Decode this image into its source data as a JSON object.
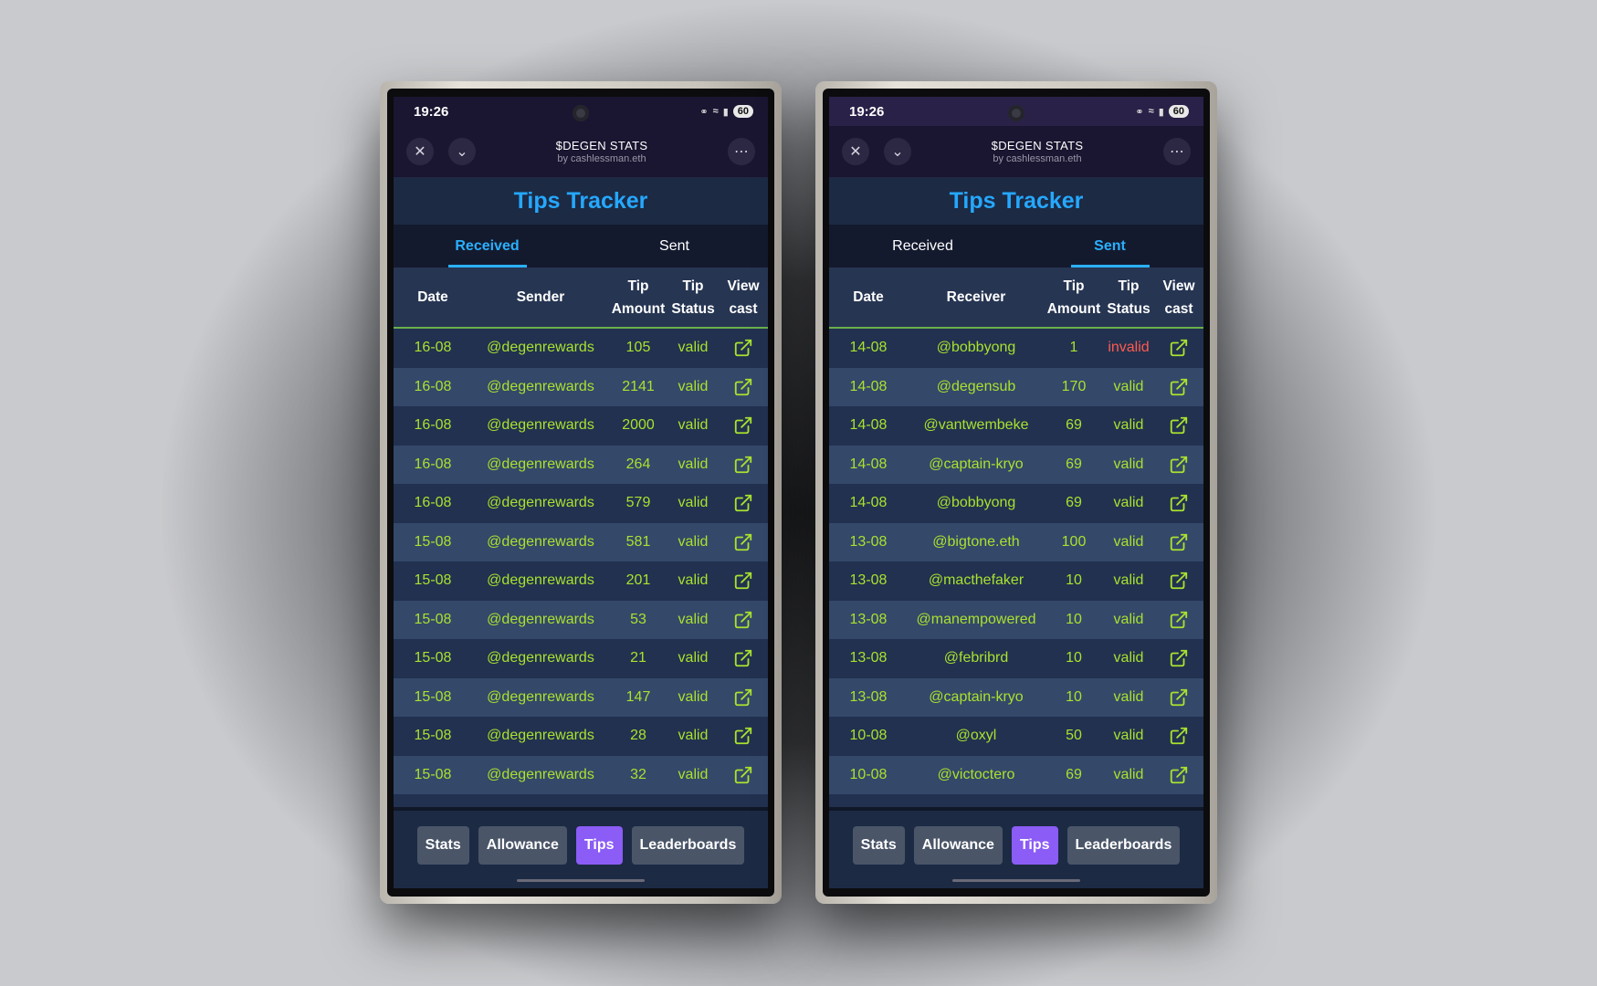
{
  "colors": {
    "accent_blue": "#25a8ff",
    "value_green": "#a8e22e",
    "invalid_red": "#ff5a4e",
    "active_nav": "#8b5cf6"
  },
  "phones": [
    {
      "status": {
        "time": "19:26",
        "battery": "60"
      },
      "app": {
        "title": "$DEGEN STATS",
        "subtitle": "by cashlessman.eth"
      },
      "heading": "Tips Tracker",
      "tabs": [
        {
          "label": "Received",
          "active": true
        },
        {
          "label": "Sent",
          "active": false
        }
      ],
      "columns": {
        "date": "Date",
        "name": "Sender",
        "amount_1": "Tip",
        "amount_2": "Amount",
        "status_1": "Tip",
        "status_2": "Status",
        "view_1": "View",
        "view_2": "cast"
      },
      "rows": [
        {
          "date": "16-08",
          "name": "@degenrewards",
          "amount": "105",
          "status": "valid"
        },
        {
          "date": "16-08",
          "name": "@degenrewards",
          "amount": "2141",
          "status": "valid"
        },
        {
          "date": "16-08",
          "name": "@degenrewards",
          "amount": "2000",
          "status": "valid"
        },
        {
          "date": "16-08",
          "name": "@degenrewards",
          "amount": "264",
          "status": "valid"
        },
        {
          "date": "16-08",
          "name": "@degenrewards",
          "amount": "579",
          "status": "valid"
        },
        {
          "date": "15-08",
          "name": "@degenrewards",
          "amount": "581",
          "status": "valid"
        },
        {
          "date": "15-08",
          "name": "@degenrewards",
          "amount": "201",
          "status": "valid"
        },
        {
          "date": "15-08",
          "name": "@degenrewards",
          "amount": "53",
          "status": "valid"
        },
        {
          "date": "15-08",
          "name": "@degenrewards",
          "amount": "21",
          "status": "valid"
        },
        {
          "date": "15-08",
          "name": "@degenrewards",
          "amount": "147",
          "status": "valid"
        },
        {
          "date": "15-08",
          "name": "@degenrewards",
          "amount": "28",
          "status": "valid"
        },
        {
          "date": "15-08",
          "name": "@degenrewards",
          "amount": "32",
          "status": "valid"
        }
      ],
      "nav": [
        {
          "label": "Stats",
          "active": false
        },
        {
          "label": "Allowance",
          "active": false
        },
        {
          "label": "Tips",
          "active": true
        },
        {
          "label": "Leaderboards",
          "active": false
        }
      ]
    },
    {
      "status": {
        "time": "19:26",
        "battery": "60"
      },
      "app": {
        "title": "$DEGEN STATS",
        "subtitle": "by cashlessman.eth"
      },
      "heading": "Tips Tracker",
      "tabs": [
        {
          "label": "Received",
          "active": false
        },
        {
          "label": "Sent",
          "active": true
        }
      ],
      "columns": {
        "date": "Date",
        "name": "Receiver",
        "amount_1": "Tip",
        "amount_2": "Amount",
        "status_1": "Tip",
        "status_2": "Status",
        "view_1": "View",
        "view_2": "cast"
      },
      "rows": [
        {
          "date": "14-08",
          "name": "@bobbyong",
          "amount": "1",
          "status": "invalid"
        },
        {
          "date": "14-08",
          "name": "@degensub",
          "amount": "170",
          "status": "valid"
        },
        {
          "date": "14-08",
          "name": "@vantwembeke",
          "amount": "69",
          "status": "valid"
        },
        {
          "date": "14-08",
          "name": "@captain-kryo",
          "amount": "69",
          "status": "valid"
        },
        {
          "date": "14-08",
          "name": "@bobbyong",
          "amount": "69",
          "status": "valid"
        },
        {
          "date": "13-08",
          "name": "@bigtone.eth",
          "amount": "100",
          "status": "valid"
        },
        {
          "date": "13-08",
          "name": "@macthefaker",
          "amount": "10",
          "status": "valid"
        },
        {
          "date": "13-08",
          "name": "@manempowered",
          "amount": "10",
          "status": "valid"
        },
        {
          "date": "13-08",
          "name": "@febribrd",
          "amount": "10",
          "status": "valid"
        },
        {
          "date": "13-08",
          "name": "@captain-kryo",
          "amount": "10",
          "status": "valid"
        },
        {
          "date": "10-08",
          "name": "@oxyl",
          "amount": "50",
          "status": "valid"
        },
        {
          "date": "10-08",
          "name": "@victoctero",
          "amount": "69",
          "status": "valid"
        }
      ],
      "nav": [
        {
          "label": "Stats",
          "active": false
        },
        {
          "label": "Allowance",
          "active": false
        },
        {
          "label": "Tips",
          "active": true
        },
        {
          "label": "Leaderboards",
          "active": false
        }
      ]
    }
  ]
}
